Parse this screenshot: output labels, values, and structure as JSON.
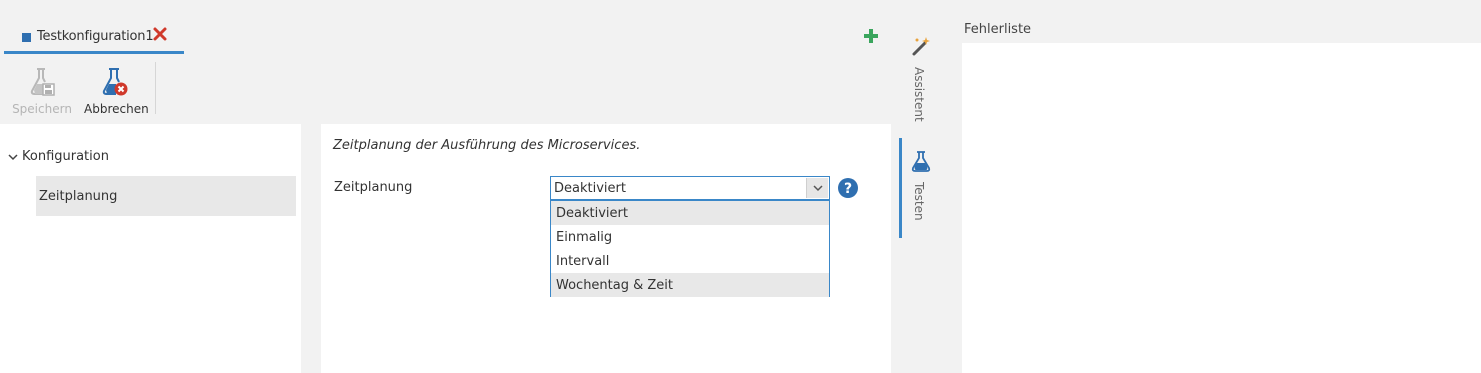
{
  "tab": {
    "title": "Testkonfiguration1"
  },
  "toolbar": {
    "save_label": "Speichern",
    "cancel_label": "Abbrechen"
  },
  "tree": {
    "root_label": "Konfiguration",
    "items": [
      {
        "label": "Zeitplanung"
      }
    ]
  },
  "form": {
    "description": "Zeitplanung der Ausführung des Microservices.",
    "field_label": "Zeitplanung",
    "selected_value": "Deaktiviert",
    "options": [
      "Deaktiviert",
      "Einmalig",
      "Intervall",
      "Wochentag & Zeit"
    ]
  },
  "side_tabs": {
    "assistant_label": "Assistent",
    "test_label": "Testen"
  },
  "error_list": {
    "title": "Fehlerliste"
  },
  "colors": {
    "accent": "#3a87c8",
    "close": "#d0392b",
    "add": "#3aa55d",
    "help": "#2f6fb0"
  },
  "icons": {
    "tab": "square-icon",
    "close": "close-icon",
    "add": "plus-icon",
    "save": "flask-save-icon",
    "cancel": "flask-cancel-icon",
    "help": "help-icon",
    "assistant": "magic-wand-icon",
    "test": "flask-icon"
  }
}
